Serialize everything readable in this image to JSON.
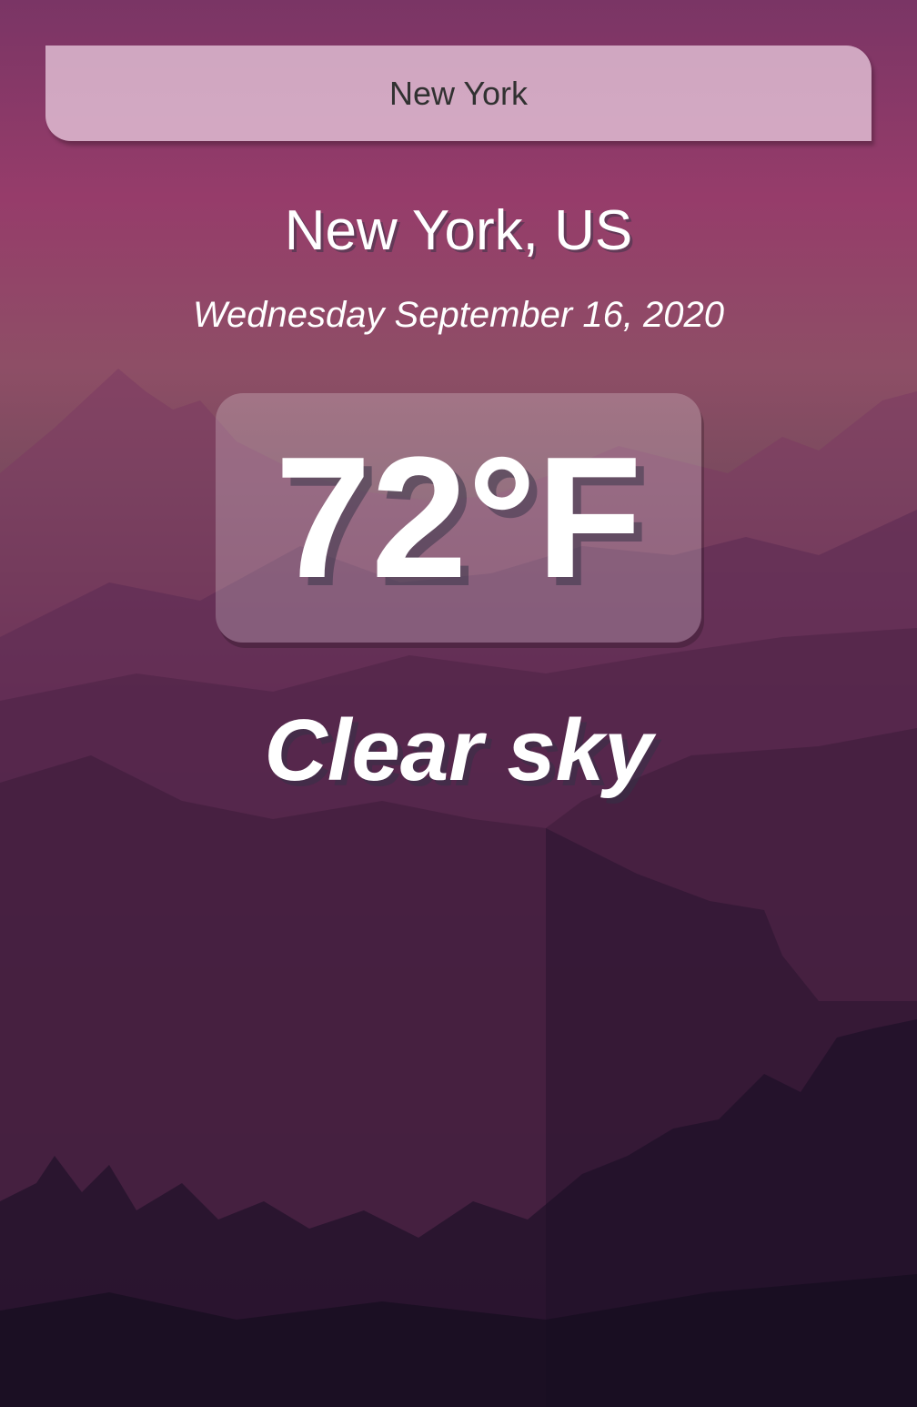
{
  "search": {
    "value": "New York"
  },
  "weather": {
    "location": "New York, US",
    "date": "Wednesday September 16, 2020",
    "temperature": "72°F",
    "condition": "Clear sky"
  },
  "colors": {
    "sky_top": "#7a3565",
    "sky_glow": "#8e4e66",
    "bottom": "#150f22",
    "text": "#ffffff",
    "search_bg": "#eed2e4"
  }
}
